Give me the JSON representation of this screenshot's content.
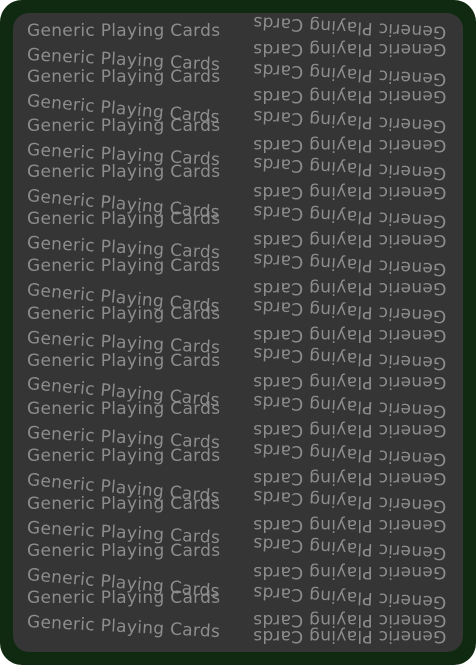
{
  "card": {
    "back_text": "Generic Playing Cards",
    "colors": {
      "border": "#0f2a10",
      "face": "#353535",
      "text": "#8d8d8d"
    }
  }
}
